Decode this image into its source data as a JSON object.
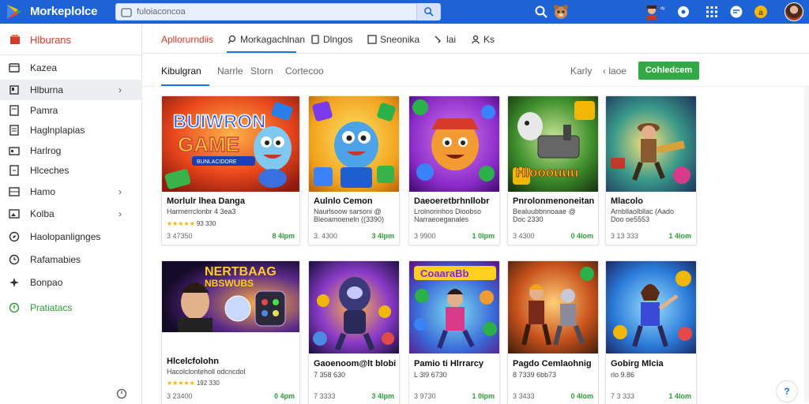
{
  "app": {
    "title": "Morkeplolce"
  },
  "search": {
    "placeholder": "fuloiaconcoa"
  },
  "topbar": {
    "badge": "ᵈʸ"
  },
  "sidebar": {
    "header": "Hlburans",
    "items": [
      {
        "label": "Kazea",
        "icon": "tag-icon"
      },
      {
        "label": "Hlburna",
        "icon": "package-icon",
        "chevron": true,
        "active": true
      },
      {
        "label": "Pamra",
        "icon": "monitor-icon"
      },
      {
        "label": "Haglnplapias",
        "icon": "document-icon"
      },
      {
        "label": "Harlrog",
        "icon": "print-icon"
      },
      {
        "label": "Hlceches",
        "icon": "file-icon"
      },
      {
        "label": "Hamo",
        "icon": "list-icon",
        "chevron": true
      },
      {
        "label": "Kolba",
        "icon": "image-icon",
        "chevron": true
      },
      {
        "label": "Haolopanlignges",
        "icon": "compass-icon"
      },
      {
        "label": "Rafamabies",
        "icon": "clock-icon"
      },
      {
        "label": "Bonpao",
        "icon": "sparkle-icon"
      },
      {
        "label": "Pratiatacs",
        "icon": "shield-icon",
        "green": true
      }
    ]
  },
  "tabs": [
    {
      "label": "Apllorurndiis",
      "icon": "",
      "active": true
    },
    {
      "label": "Morkagachlnan",
      "icon": "search-icon"
    },
    {
      "label": "Dlngos",
      "icon": "folder-icon"
    },
    {
      "label": "Sneonika",
      "icon": "square-icon"
    },
    {
      "label": "lai",
      "icon": "brush-icon"
    },
    {
      "label": "Ks",
      "icon": "person-icon"
    }
  ],
  "filters": {
    "items": [
      "Kibulgran",
      "Narrle",
      "Storn",
      "Cortecoo"
    ],
    "right": [
      "Karly",
      "‹ laoe"
    ],
    "cta": "Cohledcem"
  },
  "cards": [
    {
      "title": "Morlulr lhea Danga",
      "sub": "Harmerrclonbr 4 3ea3",
      "stars": "★★★★★",
      "rating": "93 330",
      "meta": "3 47350",
      "price": "8 4lpm"
    },
    {
      "title": "Aulnlo Cemon",
      "sub": "Naurlsoow sarsoni @",
      "sub2": "Bleoamoeneln ((3390)",
      "meta": "3. 4300",
      "price": "3 4lpm"
    },
    {
      "title": "Daeoeretbrhnllobr",
      "sub": "Lrolnorinhos Dioobso",
      "sub2": "Narraeoeganales",
      "meta": "3 9900",
      "price": "1 0lpm"
    },
    {
      "title": "Pnrolonmenoneitan",
      "sub": "Bealuubbnnoaae @",
      "sub2": "Doc 2330",
      "meta": "3 4300",
      "price": "0 4lom"
    },
    {
      "title": "Mlacolo",
      "sub": "Arnbllaolbllac (Aado",
      "sub2": "Doo oe5553",
      "meta": "3 13 333",
      "price": "1 4lom"
    },
    {
      "title": "Hlcelcfolohn",
      "sub": "Hacolclonteholl odcncdol",
      "stars": "★★★★★",
      "rating": "192 330",
      "meta": "3 23400",
      "price": "0 4pm"
    },
    {
      "title": "Gaoenoom@lt blobi",
      "sub": "7 358 630",
      "meta": "7 3333",
      "price": "3 4lpm"
    },
    {
      "title": "Pamio ti Hlrrarcy",
      "sub": "L 3l9 6730",
      "meta": "3 9730",
      "price": "1 0lpm"
    },
    {
      "title": "Pagdo Cemlaohnig",
      "sub": "8 7339 6bb73",
      "meta": "3 3433",
      "price": "0 4lom"
    },
    {
      "title": "Gobirg Mlcia",
      "sub": "rlo 9.86",
      "meta": "7 3 333",
      "price": "1 4lom"
    }
  ],
  "thumb_text": {
    "card1": [
      "BUIWRON",
      "GAME",
      "BUNLACIDORE"
    ],
    "card4": "Hlooouuu",
    "card6": [
      "NERTBAAG",
      "NBSWUBS"
    ],
    "card8": "CoaaraBb"
  },
  "colors": {
    "topbar": "#1e63d6",
    "accent_red": "#d23b2c",
    "accent_green": "#34a845",
    "link_blue": "#1a73e8"
  }
}
